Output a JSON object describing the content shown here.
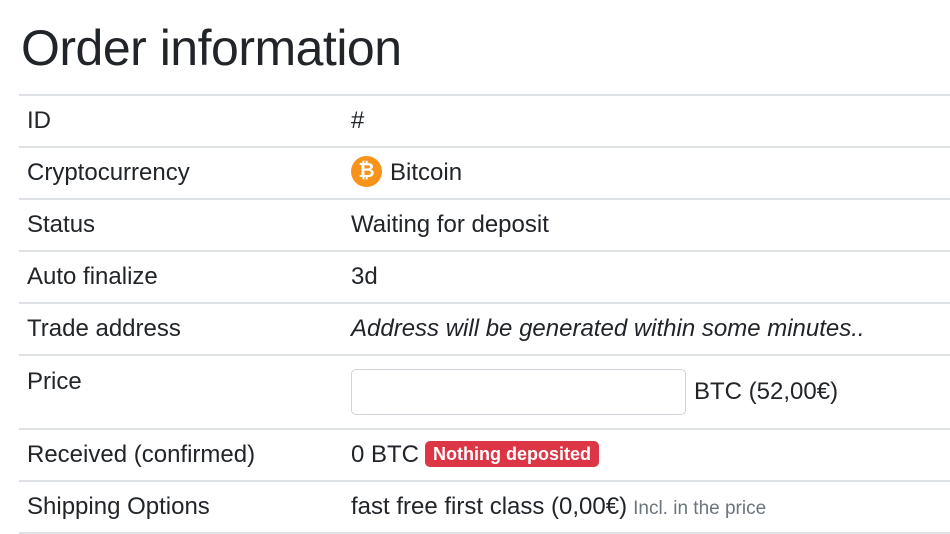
{
  "page": {
    "title": "Order information"
  },
  "rows": {
    "id": {
      "label": "ID",
      "value": "#"
    },
    "cryptocurrency": {
      "label": "Cryptocurrency",
      "value": "Bitcoin",
      "icon": "bitcoin-icon",
      "icon_glyph": "₿",
      "icon_color": "#f7931a"
    },
    "status": {
      "label": "Status",
      "value": "Waiting for deposit"
    },
    "auto_finalize": {
      "label": "Auto finalize",
      "value": "3d"
    },
    "trade_address": {
      "label": "Trade address",
      "value": "Address will be generated within some minutes.."
    },
    "price": {
      "label": "Price",
      "input_value": "",
      "unit": "BTC (52,00€)"
    },
    "received": {
      "label": "Received (confirmed)",
      "value": "0 BTC",
      "badge": "Nothing deposited",
      "badge_color": "#dc3545"
    },
    "shipping": {
      "label": "Shipping Options",
      "value": "fast free first class (0,00€)",
      "note": "Incl. in the price"
    }
  }
}
